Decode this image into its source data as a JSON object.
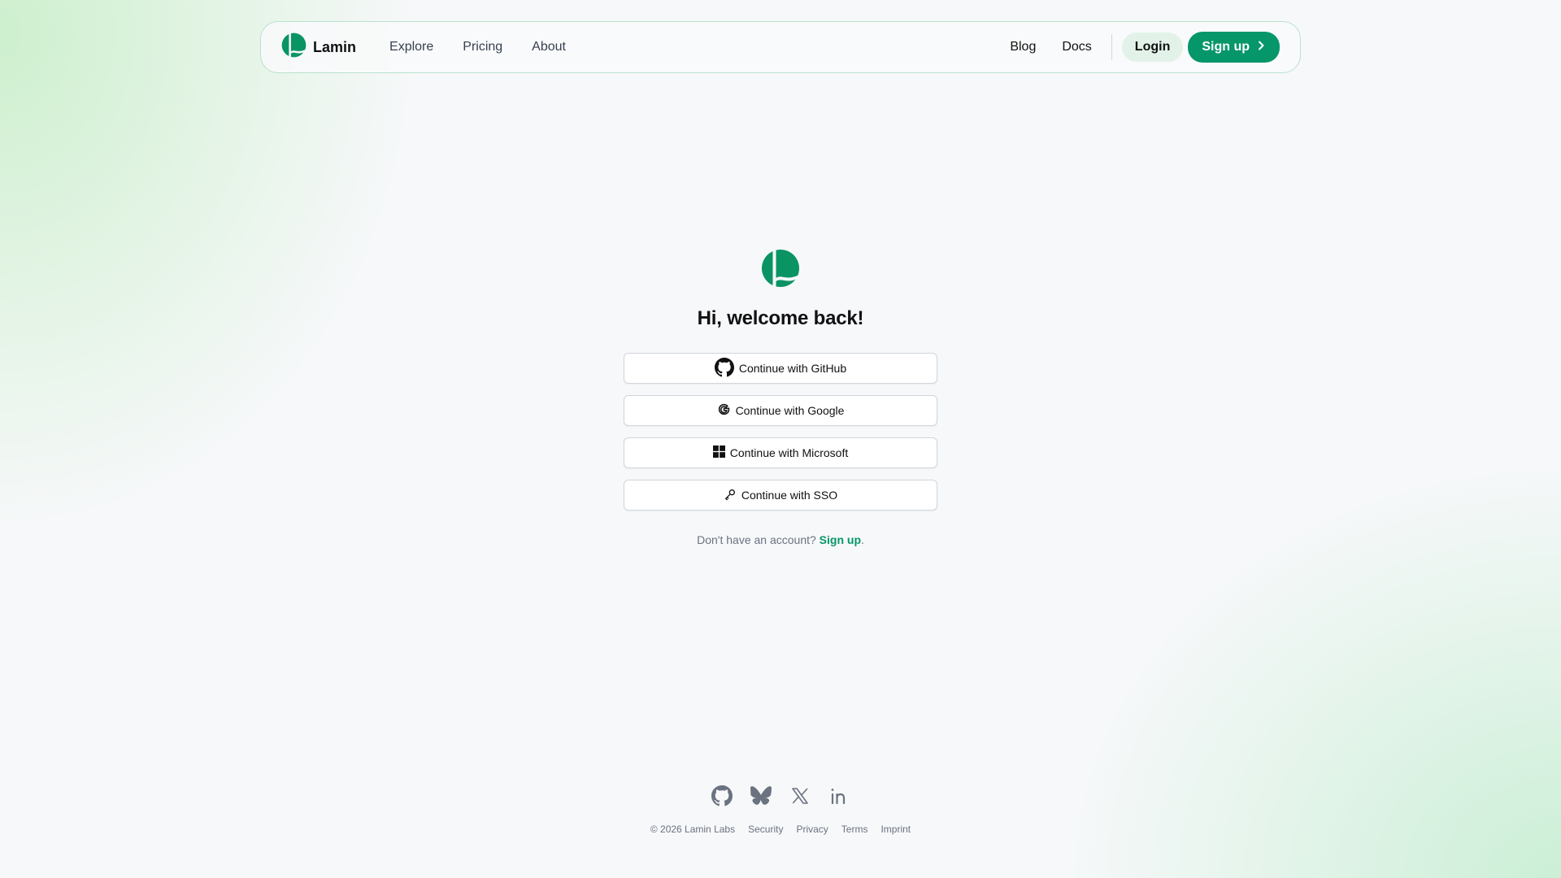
{
  "header": {
    "brand": "Lamin",
    "nav_left": [
      "Explore",
      "Pricing",
      "About"
    ],
    "nav_right": [
      "Blog",
      "Docs"
    ],
    "login_label": "Login",
    "signup_label": "Sign up"
  },
  "main": {
    "title": "Hi, welcome back!",
    "auth_buttons": [
      {
        "label": "Continue with GitHub",
        "icon": "github-icon"
      },
      {
        "label": "Continue with Google",
        "icon": "google-icon"
      },
      {
        "label": "Continue with Microsoft",
        "icon": "microsoft-icon"
      },
      {
        "label": "Continue with SSO",
        "icon": "key-icon"
      }
    ],
    "no_account_text": "Don't have an account?",
    "signup_link": "Sign up",
    "signup_period": "."
  },
  "footer": {
    "socials": [
      "github-icon",
      "bluesky-icon",
      "x-icon",
      "linkedin-icon"
    ],
    "copyright": "© 2026 Lamin Labs",
    "links": [
      "Security",
      "Privacy",
      "Terms",
      "Imprint"
    ]
  },
  "colors": {
    "brand_green": "#059669",
    "login_bg": "#e2f2e9",
    "border_accent": "#b9e2cd"
  }
}
